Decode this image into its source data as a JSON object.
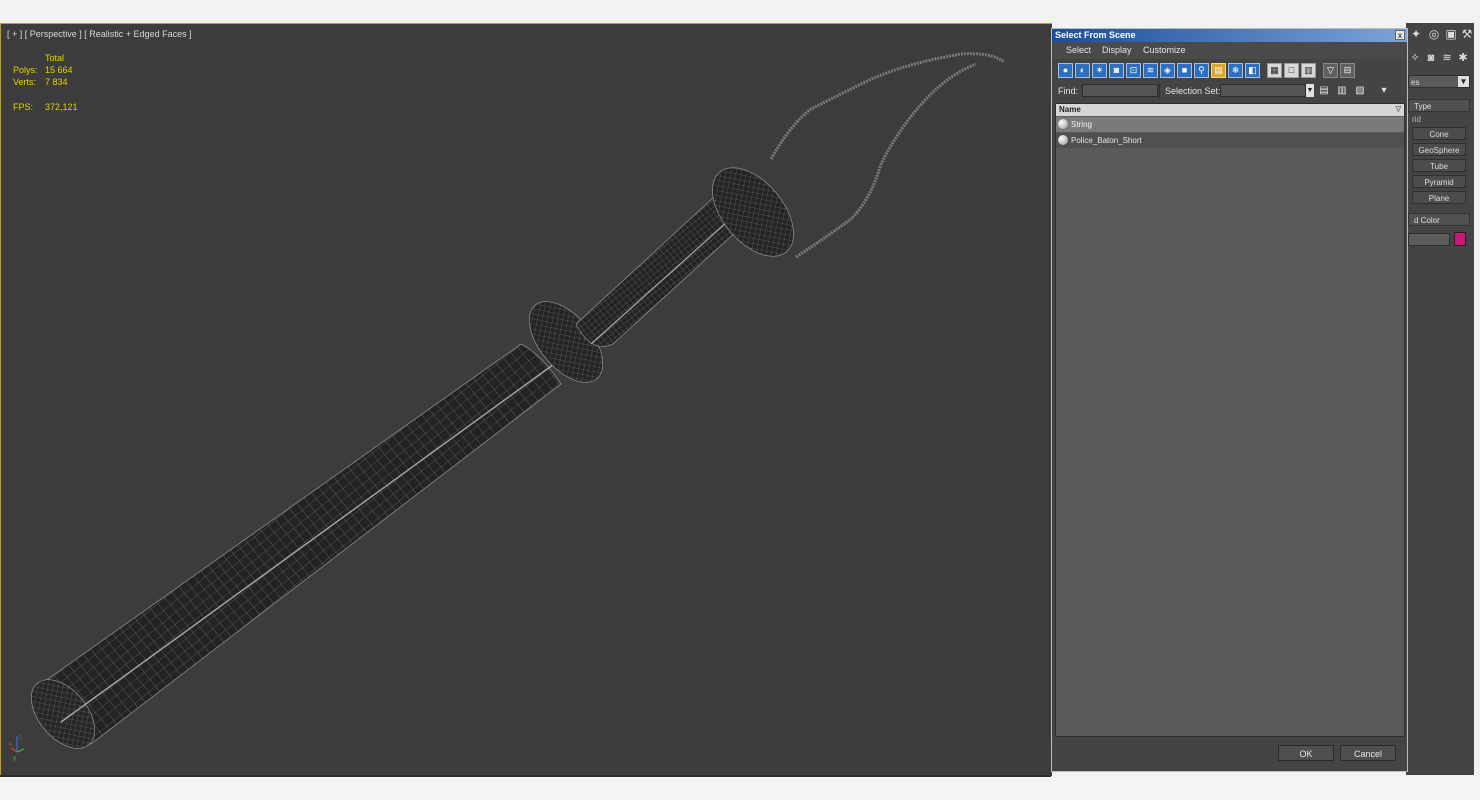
{
  "viewport": {
    "label": "[ + ] [ Perspective ] [ Realistic + Edged Faces ]",
    "stats": {
      "header": "Total",
      "polys_label": "Polys:",
      "polys_value": "15 664",
      "verts_label": "Verts:",
      "verts_value": "7 834",
      "fps_label": "FPS:",
      "fps_value": "372,121"
    }
  },
  "dialog": {
    "title": "Select From Scene",
    "close": "x",
    "menu": [
      "Select",
      "Display",
      "Customize"
    ],
    "find_label": "Find:",
    "find_value": "",
    "selection_set_label": "Selection Set:",
    "selection_set_value": "",
    "column_header": "Name",
    "items": [
      "String",
      "Police_Baton_Short"
    ],
    "ok": "OK",
    "cancel": "Cancel"
  },
  "command_panel": {
    "dropdown": "es",
    "object_type": "Type",
    "subtype": "rid",
    "buttons": [
      "Cone",
      "GeoSphere",
      "Tube",
      "Pyramid",
      "Plane"
    ],
    "name_color": "d Color",
    "swatch_color": "#c8187c"
  },
  "colors": {
    "viewport_bg": "#3c3c3c",
    "stats_text": "#e6d200",
    "title_gradient_start": "#1a4d9a",
    "accent_yellow": "#c8a000"
  }
}
